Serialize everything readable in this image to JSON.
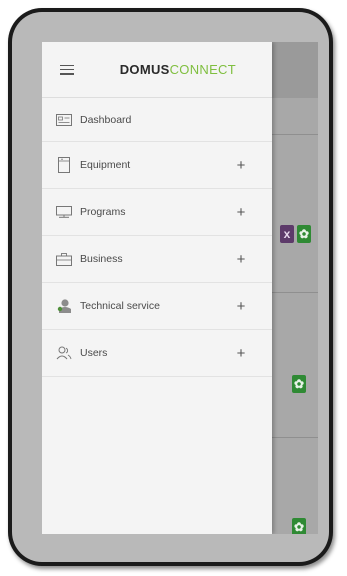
{
  "brand": {
    "part1": "DOMUS",
    "part2": "CONNECT",
    "accent": "#7fbf3f"
  },
  "drawer": {
    "items": [
      {
        "label": "Dashboard",
        "icon": "dashboard-icon",
        "expandable": false
      },
      {
        "label": "Equipment",
        "icon": "equipment-icon",
        "expandable": true
      },
      {
        "label": "Programs",
        "icon": "programs-icon",
        "expandable": true
      },
      {
        "label": "Business",
        "icon": "business-icon",
        "expandable": true
      },
      {
        "label": "Technical service",
        "icon": "technical-service-icon",
        "expandable": true
      },
      {
        "label": "Users",
        "icon": "users-icon",
        "expandable": true
      }
    ],
    "expand_symbol": "+"
  },
  "background": {
    "chip_x": "x",
    "chip_gear": "✿"
  }
}
